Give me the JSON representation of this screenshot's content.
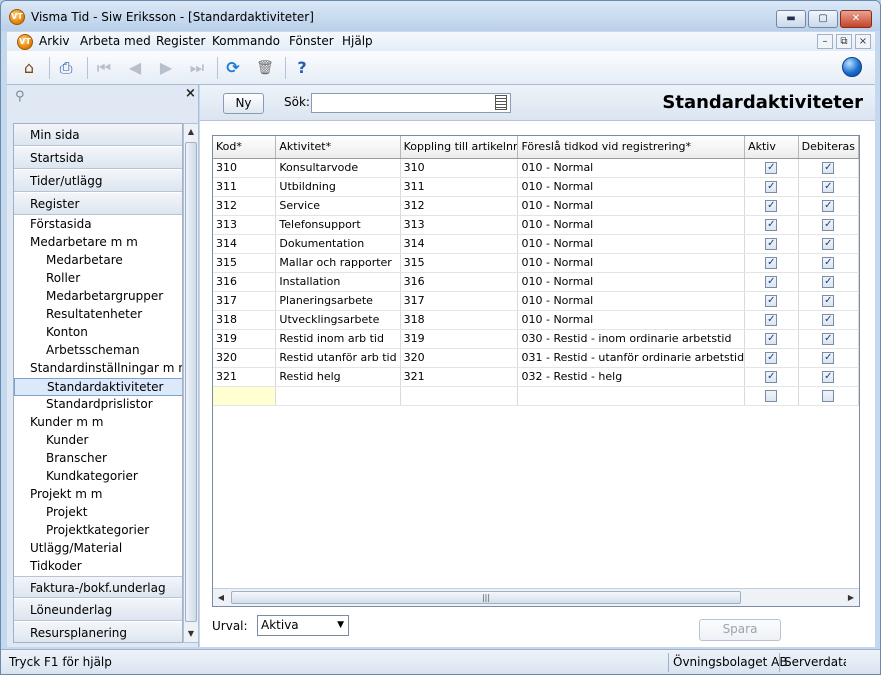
{
  "window": {
    "title": "Visma Tid - Siw Eriksson - [Standardaktiviteter]",
    "app_icon_text": "VT",
    "min_glyph": "▬",
    "max_glyph": "▢",
    "close_glyph": "✕"
  },
  "menu": {
    "items": [
      "Arkiv",
      "Arbeta med",
      "Register",
      "Kommando",
      "Fönster",
      "Hjälp"
    ],
    "mdi": [
      "–",
      "⧉",
      "×"
    ]
  },
  "toolbar": {
    "icons": [
      "home-icon",
      "print-icon",
      "first-icon",
      "prev-icon",
      "next-icon",
      "last-icon",
      "refresh-icon",
      "delete-icon",
      "help-doc-icon",
      "globe-icon"
    ],
    "glyphs": [
      "⌂",
      "⎙",
      "⏮",
      "◀",
      "▶",
      "⏭",
      "⟳",
      "🗑",
      "?"
    ]
  },
  "sidebar": {
    "close": "×",
    "bars_top": [
      "Min sida",
      "Startsida",
      "Tider/utlägg",
      "Register"
    ],
    "items": [
      {
        "label": "Förstasida",
        "level": 1
      },
      {
        "label": "Medarbetare m m",
        "level": 1
      },
      {
        "label": "Medarbetare",
        "level": 2
      },
      {
        "label": "Roller",
        "level": 2
      },
      {
        "label": "Medarbetargrupper",
        "level": 2
      },
      {
        "label": "Resultatenheter",
        "level": 2
      },
      {
        "label": "Konton",
        "level": 2
      },
      {
        "label": "Arbetsscheman",
        "level": 2
      },
      {
        "label": "Standardinställningar m m",
        "level": 1
      },
      {
        "label": "Standardaktiviteter",
        "level": 2,
        "selected": true
      },
      {
        "label": "Standardprislistor",
        "level": 2
      },
      {
        "label": "Kunder m m",
        "level": 1
      },
      {
        "label": "Kunder",
        "level": 2
      },
      {
        "label": "Branscher",
        "level": 2
      },
      {
        "label": "Kundkategorier",
        "level": 2
      },
      {
        "label": "Projekt m m",
        "level": 1
      },
      {
        "label": "Projekt",
        "level": 2
      },
      {
        "label": "Projektkategorier",
        "level": 2
      },
      {
        "label": "Utlägg/Material",
        "level": 1
      },
      {
        "label": "Tidkoder",
        "level": 1
      }
    ],
    "bars_bottom": [
      "Faktura-/bokf.underlag",
      "Löneunderlag",
      "Resursplanering"
    ]
  },
  "content": {
    "new_button": "Ny",
    "search_label": "Sök:",
    "search_value": "",
    "page_title": "Standardaktiviteter",
    "urval_label": "Urval:",
    "urval_value": "Aktiva",
    "save_button": "Spara"
  },
  "grid": {
    "columns": [
      "Kod*",
      "Aktivitet*",
      "Koppling till artikelnr",
      "Föreslå tidkod vid registrering*",
      "Aktiv",
      "Debiteras"
    ],
    "rows": [
      {
        "kod": "310",
        "aktivitet": "Konsultarvode",
        "artikel": "310",
        "tidkod": "010 - Normal",
        "aktiv": true,
        "debiteras": true
      },
      {
        "kod": "311",
        "aktivitet": "Utbildning",
        "artikel": "311",
        "tidkod": "010 - Normal",
        "aktiv": true,
        "debiteras": true
      },
      {
        "kod": "312",
        "aktivitet": "Service",
        "artikel": "312",
        "tidkod": "010 - Normal",
        "aktiv": true,
        "debiteras": true
      },
      {
        "kod": "313",
        "aktivitet": "Telefonsupport",
        "artikel": "313",
        "tidkod": "010 - Normal",
        "aktiv": true,
        "debiteras": true
      },
      {
        "kod": "314",
        "aktivitet": "Dokumentation",
        "artikel": "314",
        "tidkod": "010 - Normal",
        "aktiv": true,
        "debiteras": true
      },
      {
        "kod": "315",
        "aktivitet": "Mallar och rapporter",
        "artikel": "315",
        "tidkod": "010 - Normal",
        "aktiv": true,
        "debiteras": true
      },
      {
        "kod": "316",
        "aktivitet": "Installation",
        "artikel": "316",
        "tidkod": "010 - Normal",
        "aktiv": true,
        "debiteras": true
      },
      {
        "kod": "317",
        "aktivitet": "Planeringsarbete",
        "artikel": "317",
        "tidkod": "010 - Normal",
        "aktiv": true,
        "debiteras": true
      },
      {
        "kod": "318",
        "aktivitet": "Utvecklingsarbete",
        "artikel": "318",
        "tidkod": "010 - Normal",
        "aktiv": true,
        "debiteras": true
      },
      {
        "kod": "319",
        "aktivitet": "Restid inom arb tid",
        "artikel": "319",
        "tidkod": "030 - Restid - inom ordinarie arbetstid",
        "aktiv": true,
        "debiteras": true
      },
      {
        "kod": "320",
        "aktivitet": "Restid utanför arb tid",
        "artikel": "320",
        "tidkod": "031 - Restid - utanför ordinarie arbetstid",
        "aktiv": true,
        "debiteras": true
      },
      {
        "kod": "321",
        "aktivitet": "Restid helg",
        "artikel": "321",
        "tidkod": "032 - Restid - helg",
        "aktiv": true,
        "debiteras": true
      },
      {
        "kod": "",
        "aktivitet": "",
        "artikel": "",
        "tidkod": "",
        "aktiv": false,
        "debiteras": false,
        "new": true
      }
    ]
  },
  "statusbar": {
    "help": "Tryck F1 för hjälp",
    "company": "Övningsbolaget AB",
    "server": "Serverdatab"
  }
}
